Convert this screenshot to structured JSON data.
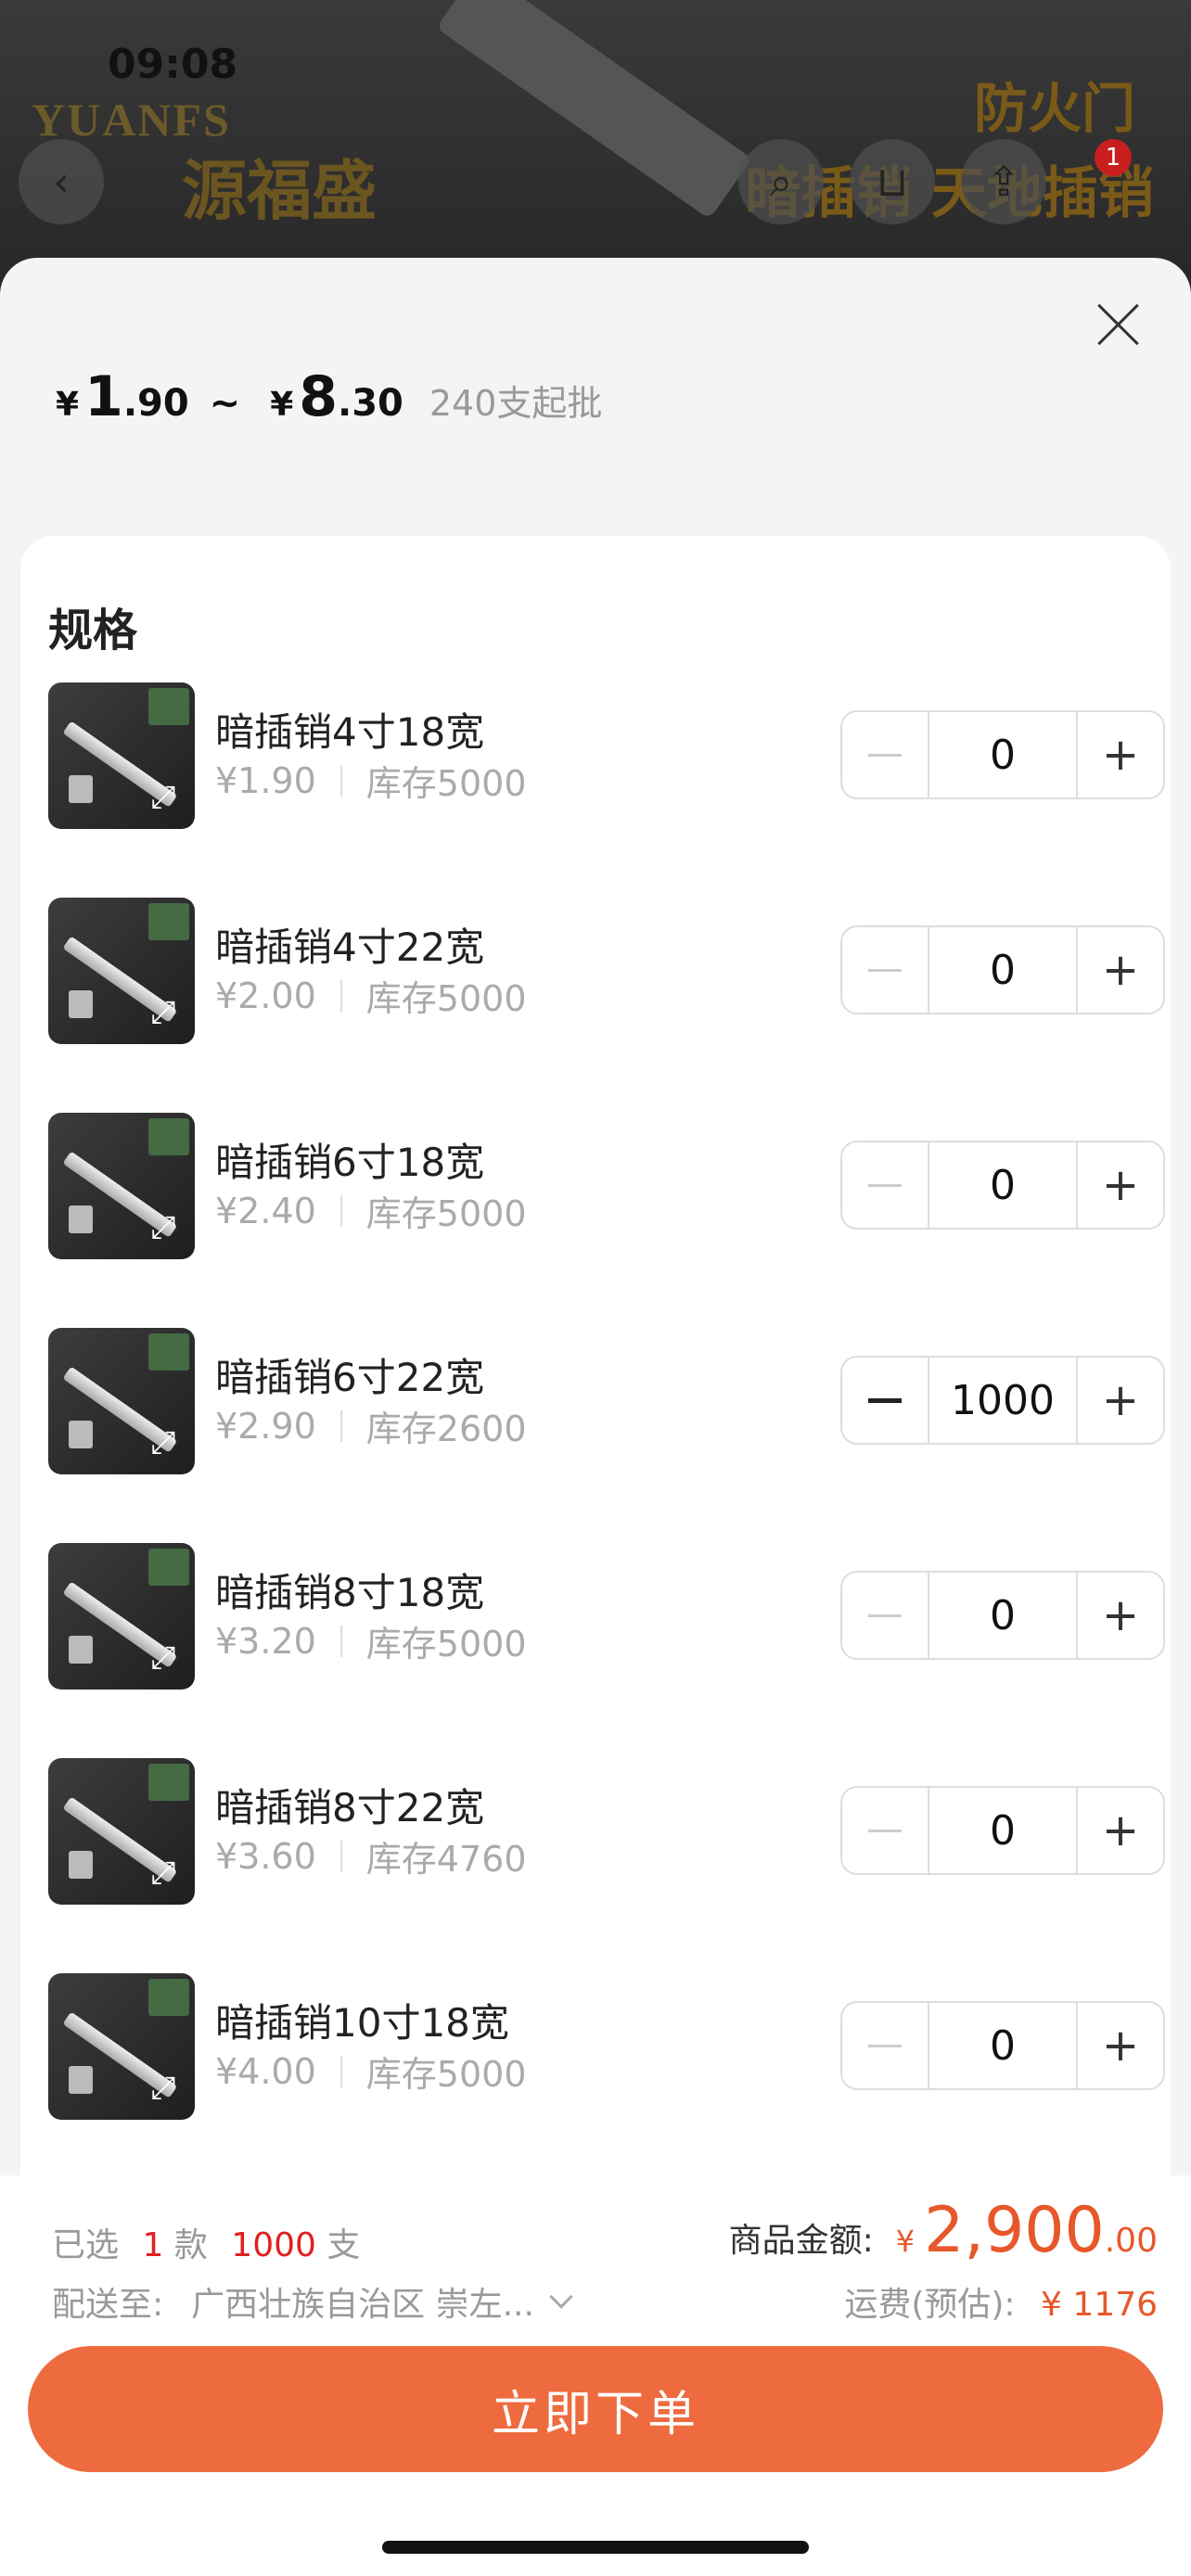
{
  "status": {
    "time": "09:08"
  },
  "background": {
    "logo_en": "YUANFS",
    "logo_cn": "源福盛",
    "title1": "防火门",
    "title2": "暗插销 天地插销",
    "cart_badge": "1"
  },
  "header": {
    "price_currency": "¥",
    "price_low_int": "1",
    "price_low_dec": ".90",
    "price_tilde": "~",
    "price_high_int": "8",
    "price_high_dec": ".30",
    "moq": "240支起批"
  },
  "spec": {
    "title": "规格",
    "items": [
      {
        "name": "暗插销4寸18宽",
        "price": "¥1.90",
        "stock": "库存5000",
        "qty": "0"
      },
      {
        "name": "暗插销4寸22宽",
        "price": "¥2.00",
        "stock": "库存5000",
        "qty": "0"
      },
      {
        "name": "暗插销6寸18宽",
        "price": "¥2.40",
        "stock": "库存5000",
        "qty": "0"
      },
      {
        "name": "暗插销6寸22宽",
        "price": "¥2.90",
        "stock": "库存2600",
        "qty": "1000"
      },
      {
        "name": "暗插销8寸18宽",
        "price": "¥3.20",
        "stock": "库存5000",
        "qty": "0"
      },
      {
        "name": "暗插销8寸22宽",
        "price": "¥3.60",
        "stock": "库存4760",
        "qty": "0"
      },
      {
        "name": "暗插销10寸18宽",
        "price": "¥4.00",
        "stock": "库存5000",
        "qty": "0"
      }
    ]
  },
  "footer": {
    "selected_prefix": "已选",
    "selected_count": "1",
    "selected_unit1": "款",
    "selected_qty": "1000",
    "selected_unit2": "支",
    "ship_label": "配送至:",
    "ship_address": "广西壮族自治区 崇左...",
    "amount_label": "商品金额:",
    "amount_currency": "¥",
    "amount_int": "2,900",
    "amount_dec": ".00",
    "freight_label": "运费(预估):",
    "freight_value": "¥ 1176",
    "order_button": "立即下单"
  }
}
